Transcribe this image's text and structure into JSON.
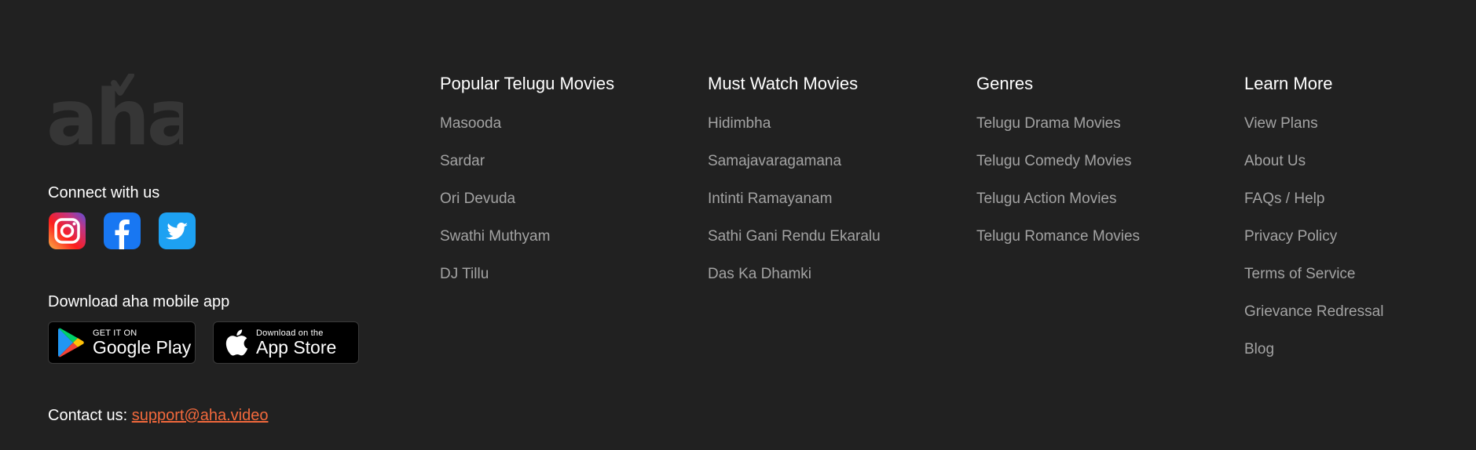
{
  "brand": {
    "logo_text": "aha"
  },
  "connect": {
    "title": "Connect with us",
    "icons": [
      "instagram-icon",
      "facebook-icon",
      "twitter-icon"
    ]
  },
  "download": {
    "title": "Download aha mobile app",
    "google_play": {
      "small": "GET IT ON",
      "big": "Google Play"
    },
    "app_store": {
      "small": "Download on the",
      "big": "App Store"
    }
  },
  "contact": {
    "label": "Contact us:",
    "email": "support@aha.video"
  },
  "columns": [
    {
      "title": "Popular Telugu Movies",
      "items": [
        "Masooda",
        "Sardar",
        "Ori Devuda",
        "Swathi Muthyam",
        "DJ Tillu"
      ]
    },
    {
      "title": "Must Watch Movies",
      "items": [
        "Hidimbha",
        "Samajavaragamana",
        "Intinti Ramayanam",
        "Sathi Gani Rendu Ekaralu",
        "Das Ka Dhamki"
      ]
    },
    {
      "title": "Genres",
      "items": [
        "Telugu Drama Movies",
        "Telugu Comedy Movies",
        "Telugu Action Movies",
        "Telugu Romance Movies"
      ]
    },
    {
      "title": "Learn More",
      "items": [
        "View Plans",
        "About Us",
        "FAQs / Help",
        "Privacy Policy",
        "Terms of Service",
        "Grievance Redressal",
        "Blog"
      ]
    }
  ],
  "colors": {
    "background": "#212121",
    "link_accent": "#f2693c",
    "item_text": "#a3a3a3",
    "logo": "#363636"
  }
}
